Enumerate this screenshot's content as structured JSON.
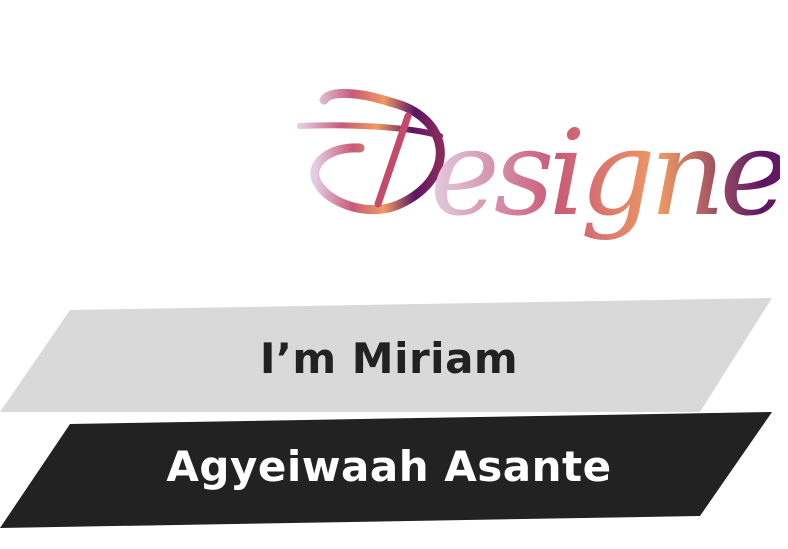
{
  "logo": {
    "text": "Designer",
    "gradient": [
      "#d9b8d6",
      "#c34a6a",
      "#f08f5c",
      "#5c1a63",
      "#7a2060"
    ]
  },
  "banners": {
    "top": {
      "text": "I’m Miriam",
      "fill": "#d9d9d9",
      "text_color": "#222222"
    },
    "bottom": {
      "text": "Agyeiwaah Asante",
      "fill": "#222222",
      "text_color": "#ffffff"
    }
  }
}
